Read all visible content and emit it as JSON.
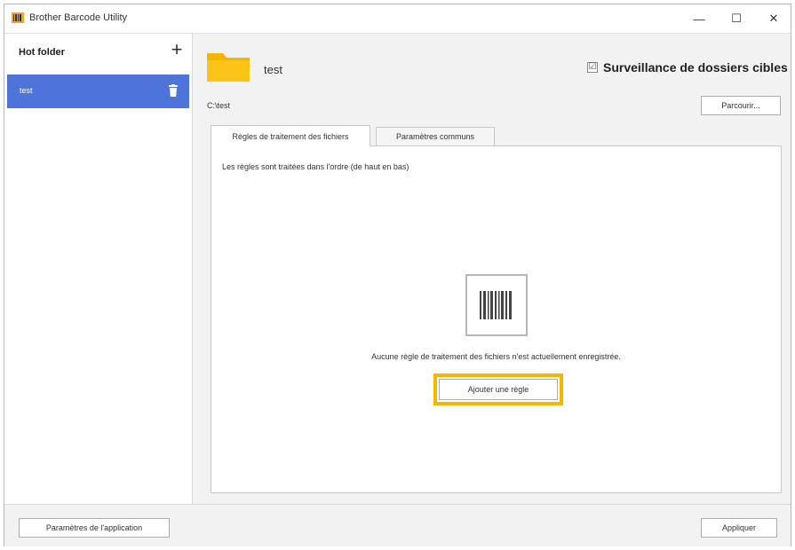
{
  "window": {
    "title": "Brother Barcode Utility",
    "controls": {
      "minimize": "—",
      "maximize": "☐",
      "close": "✕"
    }
  },
  "sidebar": {
    "title": "Hot folder",
    "add_symbol": "+",
    "items": [
      {
        "label": "test",
        "selected": true
      }
    ],
    "accent_color": "#4e73d9"
  },
  "main": {
    "folder_name": "test",
    "monitor": {
      "checked": true,
      "label": "Surveillance de dossiers cibles",
      "check_mark": "☑"
    },
    "path": "C:\\test",
    "browse_label": "Parcourir...",
    "tabs": [
      {
        "label": "Règles de traitement des fichiers",
        "active": true
      },
      {
        "label": "Paramètres communs",
        "active": false
      }
    ],
    "rules_note": "Les règles sont traitées dans l'ordre (de haut en bas)",
    "empty_message": "Aucune règle de traitement des fichiers n'est actuellement enregistrée.",
    "add_rule_label": "Ajouter une règle",
    "highlight_color": "#f2b800"
  },
  "footer": {
    "app_settings_label": "Paramètres de l'application",
    "apply_label": "Appliquer"
  },
  "icons": {
    "app": "app-icon",
    "add": "plus-icon",
    "trash": "trash-icon",
    "folder": "folder-icon",
    "barcode": "barcode-icon"
  }
}
